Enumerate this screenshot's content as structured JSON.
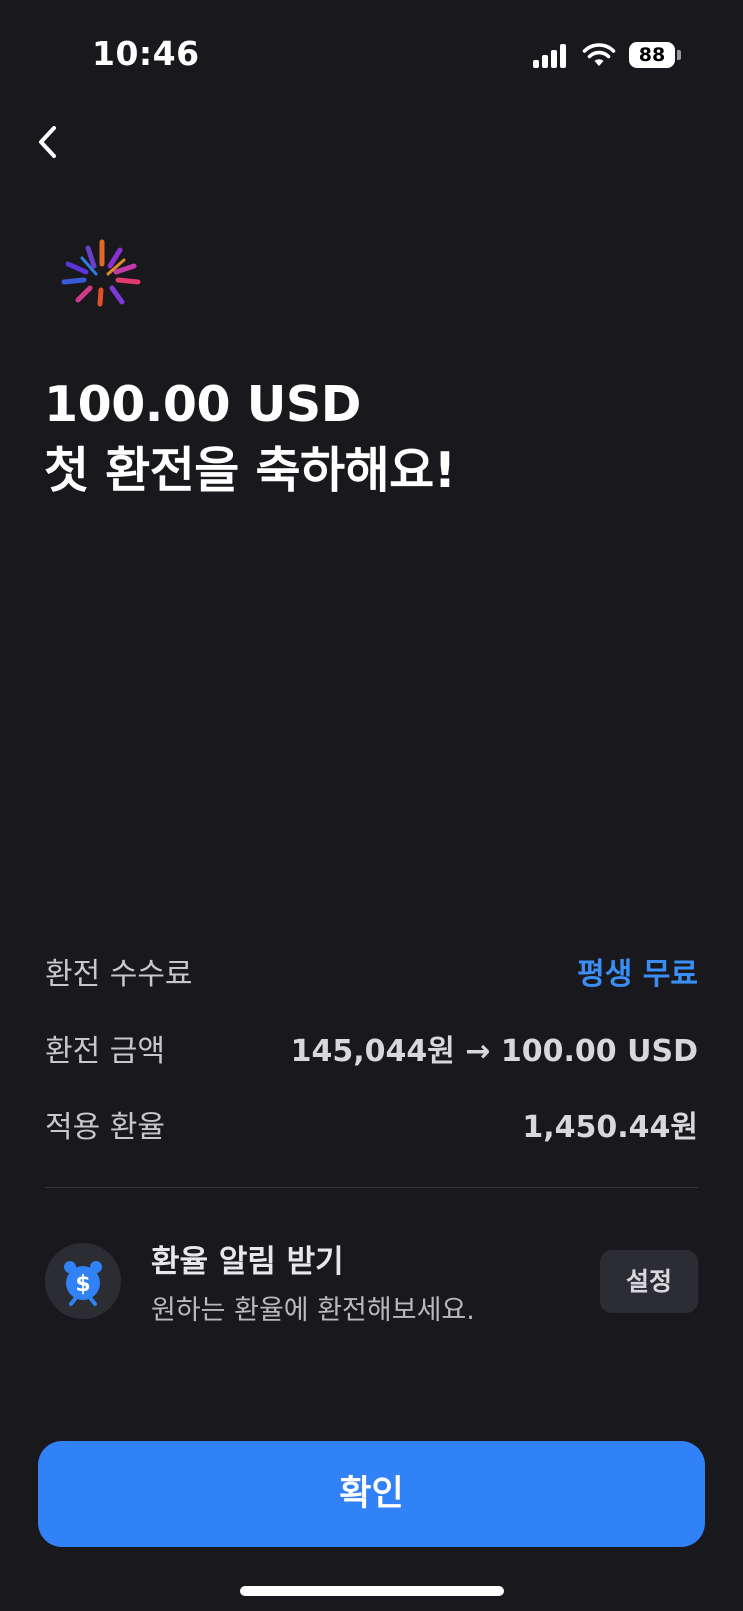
{
  "status_bar": {
    "time": "10:46",
    "battery": "88",
    "icons": [
      "cellular-signal-icon",
      "wifi-icon",
      "battery-icon"
    ]
  },
  "nav": {
    "back_icon": "chevron-left-icon"
  },
  "celebration_icon": "fireworks-icon",
  "headline": {
    "amount": "100.00 USD",
    "message": "첫 환전을 축하해요!"
  },
  "details": [
    {
      "label": "환전 수수료",
      "value": "평생 무료"
    },
    {
      "label": "환전 금액",
      "value": "145,044원 → 100.00 USD"
    },
    {
      "label": "적용 환율",
      "value": "1,450.44원"
    }
  ],
  "rate_alert": {
    "icon": "alarm-clock-dollar-icon",
    "title": "환율 알림 받기",
    "subtitle": "원하는 환율에 환전해보세요.",
    "button": "설정"
  },
  "confirm_button": "확인",
  "colors": {
    "background": "#18181d",
    "accent": "#3182f6",
    "free_text": "#3b8ef5",
    "secondary_surface": "#2c2c33"
  }
}
